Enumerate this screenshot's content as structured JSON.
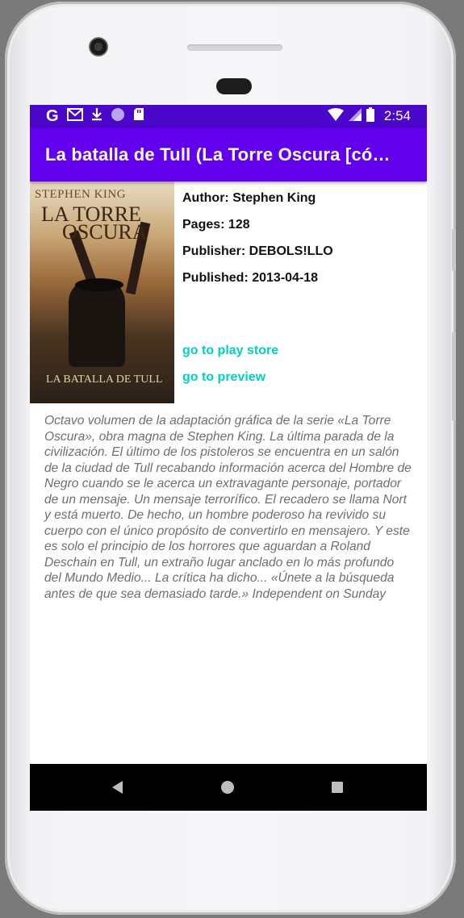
{
  "status_bar": {
    "left_icons": [
      "google-icon",
      "gmail-icon",
      "download-icon",
      "circle-app-icon",
      "sd-card-icon"
    ],
    "google_letter": "G",
    "time": "2:54",
    "right_icons": [
      "wifi-icon",
      "signal-icon",
      "battery-icon"
    ]
  },
  "app_bar": {
    "title": "La batalla de Tull (La Torre Oscura [có…"
  },
  "book": {
    "cover": {
      "author": "STEPHEN KING",
      "title_line1": "LA TORRE",
      "title_line2": "OSCURA",
      "subtitle": "LA BATALLA DE TULL"
    },
    "author": "Author: Stephen King",
    "pages": "Pages: 128",
    "publisher": "Publisher: DEBOLS!LLO",
    "published": "Published: 2013-04-18",
    "play_store_link": "go to play store",
    "preview_link": "go to preview",
    "description": "Octavo volumen de la adaptación gráfica de la serie «La Torre Oscura», obra magna de Stephen King. La última parada de la civilización. El último de los pistoleros se encuentra en un salón de la ciudad de Tull recabando información acerca del Hombre de Negro cuando se le acerca un extravagante personaje, portador de un mensaje. Un mensaje terrorífico. El recadero se llama Nort y está muerto. De hecho, un hombre poderoso ha revivido su cuerpo con el único propósito de convertirlo en mensajero. Y este es solo el principio de los horrores que aguardan a Roland Deschain en Tull, un extraño lugar anclado en lo más profundo del Mundo Medio... La crítica ha dicho... «Únete a la búsqueda antes de que sea demasiado tarde.» Independent on Sunday"
  },
  "nav_bar": {
    "buttons": [
      "back-icon",
      "home-icon",
      "recents-icon"
    ]
  },
  "colors": {
    "status_bar": "#4a07c9",
    "app_bar": "#6200ee",
    "link": "#00d1c1",
    "description_text": "#6f6f6f"
  }
}
